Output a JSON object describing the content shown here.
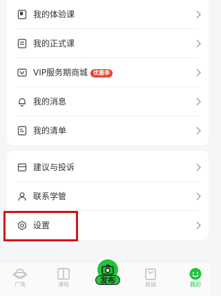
{
  "menu_group_1": {
    "items": [
      {
        "label": "我的体验课",
        "icon": "trial-course-icon"
      },
      {
        "label": "我的正式课",
        "icon": "formal-course-icon"
      },
      {
        "label": "VIP服务期商城",
        "badge": "优惠季",
        "icon": "vip-icon"
      },
      {
        "label": "我的消息",
        "icon": "bell-icon"
      },
      {
        "label": "我的清单",
        "icon": "checklist-icon"
      }
    ]
  },
  "menu_group_2": {
    "items": [
      {
        "label": "建议与投诉",
        "icon": "feedback-icon"
      },
      {
        "label": "联系学管",
        "icon": "contact-icon"
      },
      {
        "label": "设置",
        "icon": "settings-icon"
      }
    ]
  },
  "tabbar": {
    "items": [
      {
        "label": "广场",
        "icon": "planet-icon",
        "active": false
      },
      {
        "label": "课程",
        "icon": "book-icon",
        "active": false
      },
      {
        "label": "发布",
        "icon": "camera-icon",
        "active": false
      },
      {
        "label": "商城",
        "icon": "shopping-bag-icon",
        "active": false
      },
      {
        "label": "我的",
        "icon": "smiley-face-icon",
        "active": true
      }
    ]
  },
  "colors": {
    "accent": "#22c33c",
    "badge": "#e8412e",
    "highlight": "#d0141a"
  }
}
